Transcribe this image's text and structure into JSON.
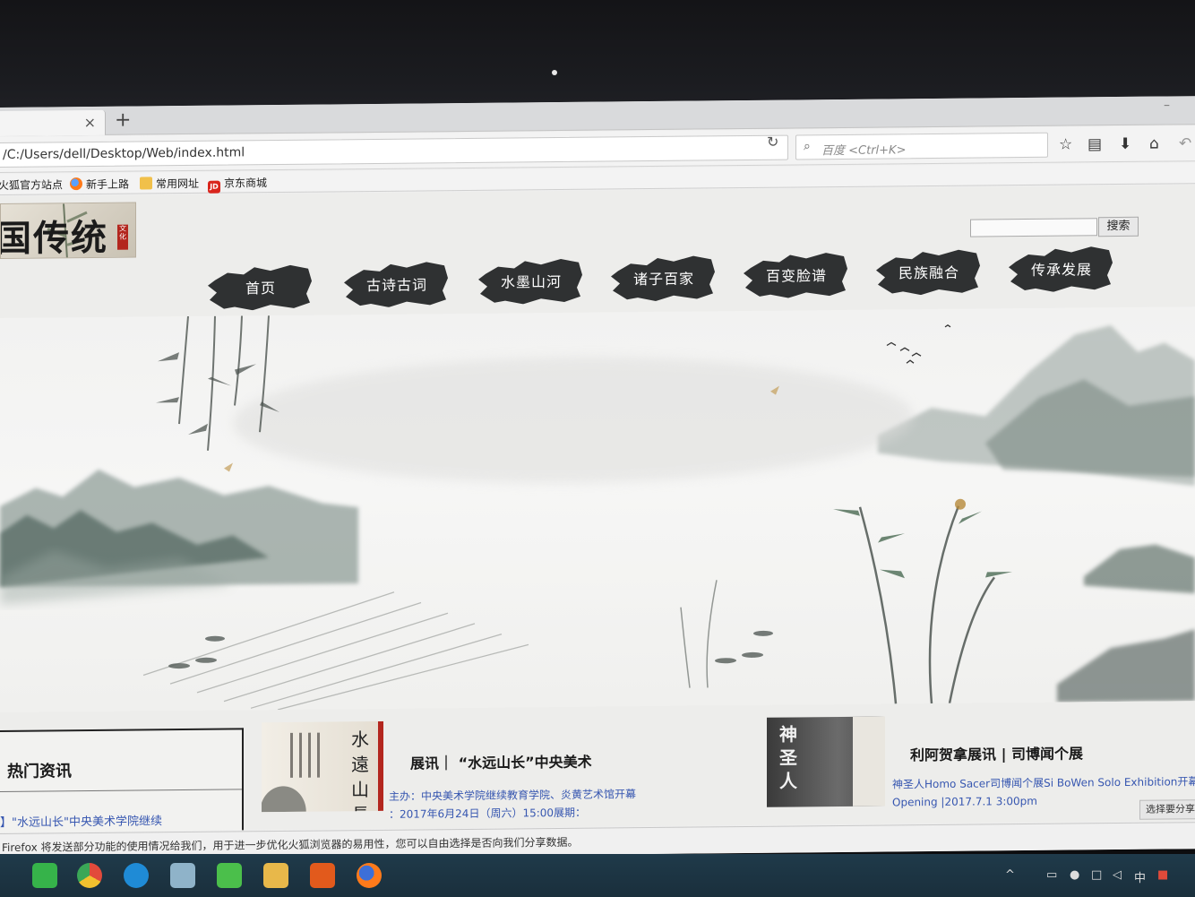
{
  "browser": {
    "tab_close": "×",
    "new_tab": "+",
    "url": "/C:/Users/dell/Desktop/Web/index.html",
    "search_placeholder": "百度 <Ctrl+K>",
    "bookmarks": [
      "火狐官方站点",
      "新手上路",
      "常用网址",
      "京东商城"
    ],
    "bookmark_jd_badge": "JD"
  },
  "site": {
    "logo_text": "国传统",
    "logo_seal": "文化",
    "search_button": "搜索",
    "nav": [
      "首页",
      "古诗古词",
      "水墨山河",
      "诸子百家",
      "百变脸谱",
      "民族融合",
      "传承发展"
    ]
  },
  "news": {
    "title": "热门资讯",
    "item": "】\"水远山长\"中央美术学院继续"
  },
  "feature1": {
    "thumb_text": "水遠山長",
    "title": "展讯｜ “水远山长”中央美术",
    "desc_line1": "主办：中央美术学院继续教育学院、炎黄艺术馆开幕",
    "desc_line2": "：2017年6月24日（周六）15:00展期："
  },
  "feature2": {
    "thumb_text": "神圣人",
    "title": "利阿贺拿展讯 | 司博闻个展",
    "desc_line1": "神圣人Homo Sacer司博闻个展Si BoWen Solo Exhibition开幕",
    "desc_line2": "Opening |2017.7.1 3:00pm"
  },
  "notification": {
    "text": "Firefox 将发送部分功能的使用情况给我们，用于进一步优化火狐浏览器的易用性，您可以自由选择是否向我们分享数据。",
    "button": "选择要分享"
  },
  "taskbar": {
    "ime": "中"
  }
}
